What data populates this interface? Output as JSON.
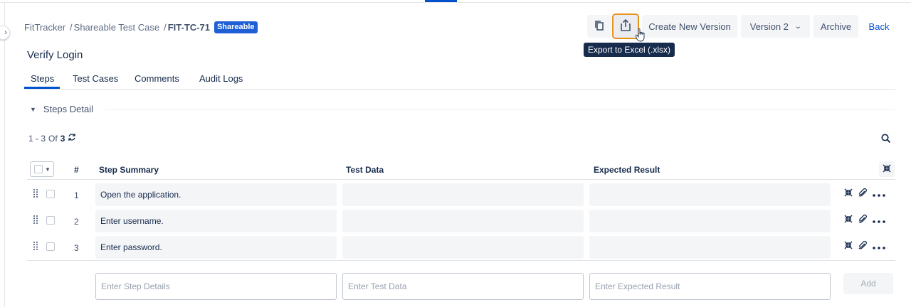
{
  "breadcrumb": {
    "items": [
      "FitTracker",
      "Shareable Test Case"
    ],
    "separator": "/",
    "current": "FIT-TC-71",
    "badge": "Shareable"
  },
  "page": {
    "title": "Verify Login"
  },
  "toolbar": {
    "copy_icon": "copy-icon",
    "export_icon": "share-upload-icon",
    "create_version_label": "Create New Version",
    "version_label": "Version 2",
    "archive_label": "Archive",
    "back_label": "Back",
    "tooltip": "Export to Excel (.xlsx)"
  },
  "tabs": [
    {
      "label": "Steps",
      "active": true
    },
    {
      "label": "Test Cases",
      "active": false
    },
    {
      "label": "Comments",
      "active": false
    },
    {
      "label": "Audit Logs",
      "active": false
    }
  ],
  "section": {
    "title": "Steps Detail",
    "expanded": true
  },
  "pager": {
    "range": "1 - 3",
    "of_label": "Of",
    "total": "3"
  },
  "table": {
    "columns": {
      "num": "#",
      "summary": "Step Summary",
      "data": "Test Data",
      "expected": "Expected Result"
    },
    "rows": [
      {
        "num": "1",
        "summary": "Open the application.",
        "data": "",
        "expected": ""
      },
      {
        "num": "2",
        "summary": "Enter username.",
        "data": "",
        "expected": ""
      },
      {
        "num": "3",
        "summary": "Enter password.",
        "data": "",
        "expected": ""
      }
    ]
  },
  "new_step": {
    "details_placeholder": "Enter Step Details",
    "data_placeholder": "Enter Test Data",
    "expected_placeholder": "Enter Expected Result",
    "add_label": "Add"
  },
  "colors": {
    "accent": "#0052cc",
    "badge": "#1f5fd6",
    "highlight": "#e8921e"
  }
}
